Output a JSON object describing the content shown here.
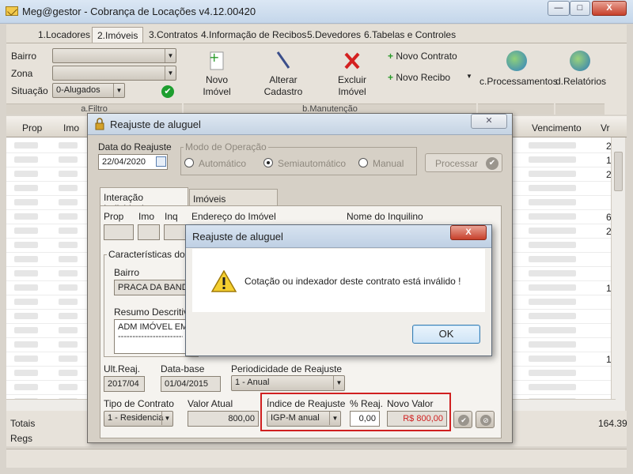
{
  "app": {
    "title": "Meg@gestor - Cobrança de Locações v4.12.00420",
    "window_buttons": {
      "minimize": "—",
      "maximize": "□",
      "close": "X"
    }
  },
  "menu": {
    "tabs": [
      {
        "label": "1.Locadores"
      },
      {
        "label": "2.Imóveis"
      },
      {
        "label": "3.Contratos"
      },
      {
        "label": "4.Informação de Recibos"
      },
      {
        "label": "5.Devedores"
      },
      {
        "label": "6.Tabelas e Controles"
      }
    ]
  },
  "filter": {
    "bairro_label": "Bairro",
    "zona_label": "Zona",
    "situacao_label": "Situação",
    "situacao_value": "0-Alugados",
    "section_label": "a.Filtro"
  },
  "toolbar": {
    "novo_imovel": "Novo\nImóvel",
    "alterar_cadastro": "Alterar\nCadastro",
    "excluir_imovel": "Excluir\nImóvel",
    "novo_contrato": "Novo Contrato",
    "novo_recibo": "Novo Recibo",
    "processamentos": "c.Processamentos",
    "relatorios": "d.Relatórios",
    "section_label": "b.Manutenção"
  },
  "grid": {
    "headers": {
      "prop": "Prop",
      "imo": "Imo",
      "vencimento": "Vencimento",
      "vr": "Vr"
    },
    "right_digits": [
      "2",
      "1",
      "2",
      "",
      "",
      "6",
      "2",
      "",
      "",
      "",
      "1",
      "",
      "",
      "",
      "",
      "1",
      "",
      "",
      ""
    ]
  },
  "footer": {
    "totais_label": "Totais",
    "regs_label": "Regs",
    "total_value": "164.39"
  },
  "reajuste": {
    "title": "Reajuste de aluguel",
    "data_label": "Data do Reajuste",
    "data_value": "22/04/2020",
    "modo_label": "Modo de Operação",
    "modo_automatico": "Automático",
    "modo_semi": "Semiautomático",
    "modo_manual": "Manual",
    "processar": "Processar",
    "tab_individual": "Interação Individual",
    "tab_reajustados": "Imóveis Reajustados",
    "prop_label": "Prop",
    "imo_label": "Imo",
    "inq_label": "Inq",
    "endereco_label": "Endereço do Imóvel",
    "nome_inquilino_label": "Nome do Inquilino",
    "caracteristicas_label": "Características do",
    "bairro_label": "Bairro",
    "bairro_value": "PRACA DA BANDEI",
    "resumo_label": "Resumo Descritivo",
    "resumo_value": "ADM IMÓVEL EM:",
    "resumo_dashes": "------------------------",
    "ult_reaj_label": "Ult.Reaj.",
    "ult_reaj_value": "2017/04",
    "data_base_label": "Data-base",
    "data_base_value": "01/04/2015",
    "periodicidade_label": "Periodicidade de Reajuste",
    "periodicidade_value": "1 - Anual",
    "tipo_contrato_label": "Tipo de Contrato",
    "tipo_contrato_value": "1 - Residencia",
    "valor_atual_label": "Valor Atual",
    "valor_atual_value": "800,00",
    "indice_label": "Índice de Reajuste",
    "indice_value": "IGP-M anual",
    "perc_label": "% Reaj.",
    "perc_value": "0,00",
    "novo_valor_label": "Novo Valor",
    "novo_valor_value": "R$ 800,00",
    "accent_red": "#d02020"
  },
  "dialog": {
    "title": "Reajuste de aluguel",
    "message": "Cotação ou indexador deste contrato está inválido !",
    "ok": "OK",
    "close": "X"
  }
}
